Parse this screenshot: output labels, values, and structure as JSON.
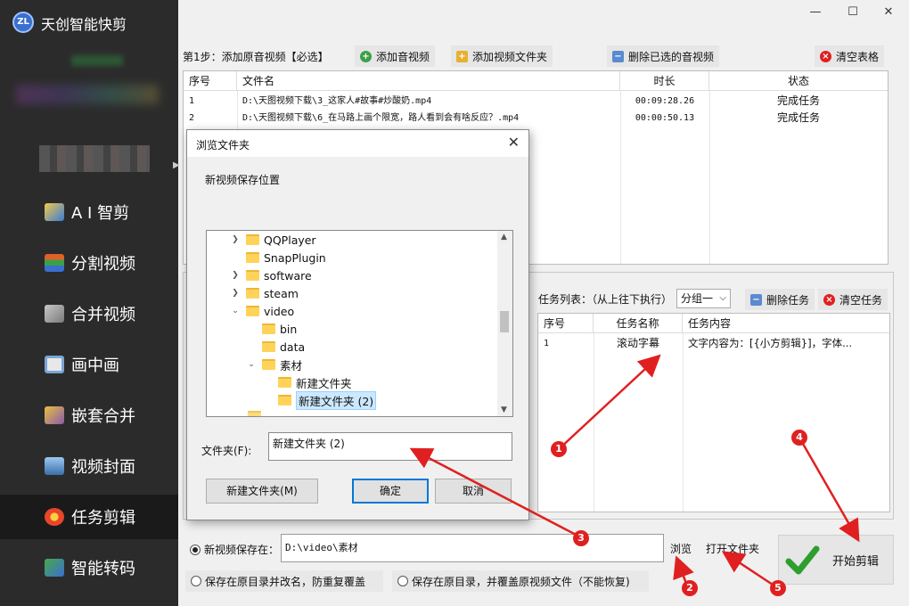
{
  "app": {
    "title": "天创智能快剪",
    "logo_text": "ZL"
  },
  "sidebar": {
    "items": [
      {
        "label": "A I 智剪",
        "icon": "ai-wand-icon",
        "color": "#3a7bd5",
        "active": false
      },
      {
        "label": "分割视频",
        "icon": "split-video-icon",
        "color": "#e0602a",
        "active": false
      },
      {
        "label": "合并视频",
        "icon": "merge-video-icon",
        "color": "#9aa0a6",
        "active": false
      },
      {
        "label": "画中画",
        "icon": "picture-in-picture-icon",
        "color": "#7aa6d8",
        "active": false
      },
      {
        "label": "嵌套合并",
        "icon": "nested-merge-icon",
        "color": "#e8c040",
        "active": false
      },
      {
        "label": "视频封面",
        "icon": "video-cover-icon",
        "color": "#5b8ed6",
        "active": false
      },
      {
        "label": "任务剪辑",
        "icon": "task-edit-icon",
        "color": "#e8452a",
        "active": true
      },
      {
        "label": "智能转码",
        "icon": "smart-transcode-icon",
        "color": "#4aa84a",
        "active": false
      }
    ]
  },
  "toolbar": {
    "step_label": "第1步：添加原音视频【必选】",
    "add_video": "添加音视频",
    "add_folder": "添加视频文件夹",
    "delete_selected": "删除已选的音视频",
    "clear_table": "清空表格"
  },
  "file_table": {
    "headers": [
      "序号",
      "文件名",
      "时长",
      "状态"
    ],
    "rows": [
      {
        "index": "1",
        "name": "D:\\天图视频下载\\3_这家人#故事#炒酸奶.mp4",
        "duration": "00:09:28.26",
        "status": "完成任务"
      },
      {
        "index": "2",
        "name": "D:\\天图视频下载\\6_在马路上画个限宽，路人看到会有啥反应？.mp4",
        "duration": "00:00:50.13",
        "status": "完成任务"
      }
    ]
  },
  "task_panel": {
    "list_label": "任务列表：（从上往下执行）",
    "group_value": "分组一",
    "delete_task": "删除任务",
    "clear_tasks": "清空任务",
    "headers": [
      "序号",
      "任务名称",
      "任务内容"
    ],
    "rows": [
      {
        "index": "1",
        "name": "滚动字幕",
        "content": "文字内容为：[{小方剪辑}]，字体..."
      }
    ]
  },
  "save": {
    "new_save_label": "新视频保存在：",
    "path": "D:\\video\\素材",
    "browse": "浏览",
    "open_folder": "打开文件夹",
    "option_rename": "保存在原目录并改名，防重复覆盖",
    "option_overwrite": "保存在原目录，并覆盖原视频文件（不能恢复)"
  },
  "start_button": {
    "label": "开始剪辑"
  },
  "dialog": {
    "title": "浏览文件夹",
    "description": "新视频保存位置",
    "tree": [
      {
        "label": "QQPlayer",
        "arrow": ">",
        "level": 0,
        "selected": false
      },
      {
        "label": "SnapPlugin",
        "arrow": "",
        "level": 0,
        "selected": false
      },
      {
        "label": "software",
        "arrow": ">",
        "level": 0,
        "selected": false
      },
      {
        "label": "steam",
        "arrow": ">",
        "level": 0,
        "selected": false
      },
      {
        "label": "video",
        "arrow": "v",
        "level": 0,
        "selected": false
      },
      {
        "label": "bin",
        "arrow": "",
        "level": 1,
        "selected": false
      },
      {
        "label": "data",
        "arrow": "",
        "level": 1,
        "selected": false
      },
      {
        "label": "素材",
        "arrow": "v",
        "level": 1,
        "selected": false
      },
      {
        "label": "新建文件夹",
        "arrow": "",
        "level": 2,
        "selected": false
      },
      {
        "label": "新建文件夹 (2)",
        "arrow": "",
        "level": 2,
        "selected": true
      }
    ],
    "folder_label": "文件夹(F):",
    "folder_value": "新建文件夹 (2)",
    "new_folder": "新建文件夹(M)",
    "ok": "确定",
    "cancel": "取消"
  },
  "annotations": [
    "1",
    "2",
    "3",
    "4",
    "5"
  ],
  "colors": {
    "accent_red": "#e02020",
    "selection_blue": "#cce8ff",
    "start_green": "#2e9e2e"
  }
}
